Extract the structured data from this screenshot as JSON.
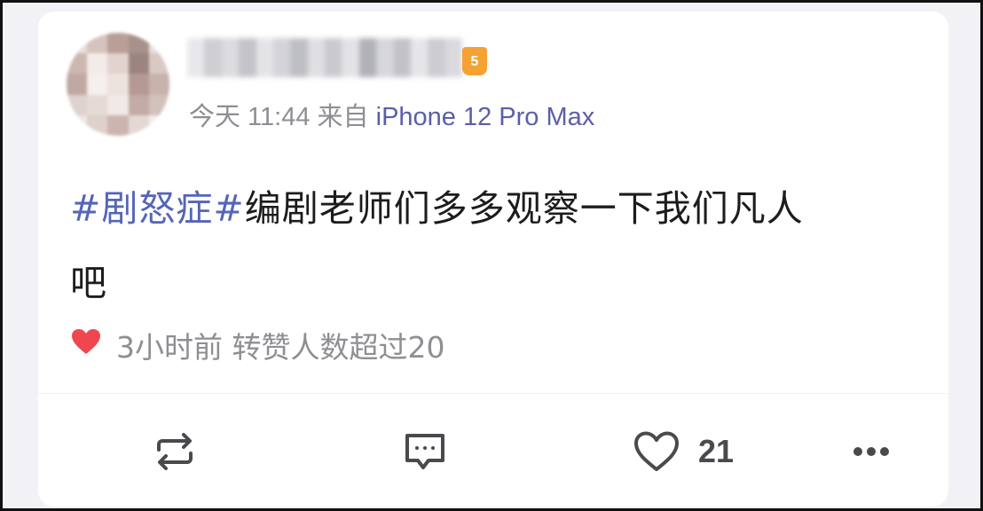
{
  "post": {
    "author": {
      "name_obscured": true,
      "badge_label": "5"
    },
    "time": "今天 11:44",
    "source_prefix": "来自",
    "device": "iPhone 12 Pro Max",
    "hashtag": "#剧怒症#",
    "content_line1": "编剧老师们多多观察一下我们凡人",
    "content_line2": "吧",
    "status_icon": "heart-icon",
    "status_text": "3小时前 转赞人数超过20"
  },
  "actions": {
    "repost_icon": "repost-icon",
    "comment_icon": "comment-icon",
    "like_icon": "like-icon",
    "like_count": "21",
    "more_icon": "more-icon"
  },
  "colors": {
    "hashtag": "#5565b8",
    "device": "#5a5fa8",
    "heart": "#f0474f",
    "badge": "#f5a233"
  }
}
